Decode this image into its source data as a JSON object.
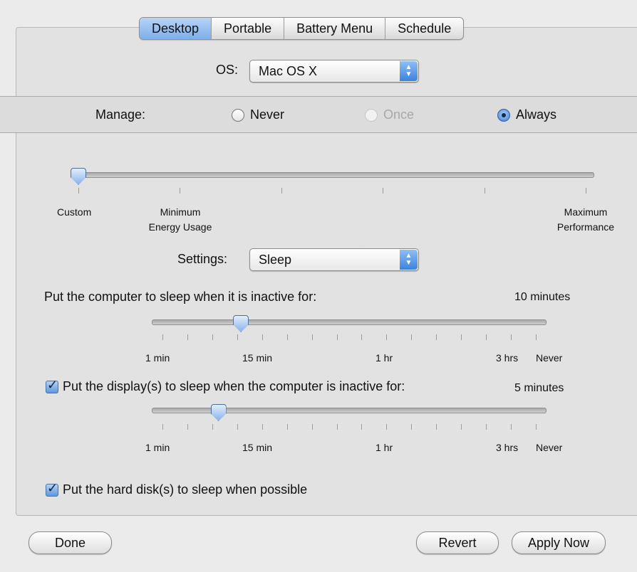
{
  "tabs": [
    "Desktop",
    "Portable",
    "Battery Menu",
    "Schedule"
  ],
  "os": {
    "label": "OS:",
    "value": "Mac OS X"
  },
  "manage": {
    "label": "Manage:",
    "options": [
      "Never",
      "Once",
      "Always"
    ],
    "selected": "Always",
    "disabled": [
      "Once"
    ]
  },
  "profile_slider": {
    "label_custom": "Custom",
    "label_min_1": "Minimum",
    "label_min_2": "Energy Usage",
    "label_max_1": "Maximum",
    "label_max_2": "Performance",
    "position": 0
  },
  "settings": {
    "label": "Settings:",
    "value": "Sleep"
  },
  "computer_sleep": {
    "label": "Put the computer to sleep when it is inactive for:",
    "value": "10 minutes",
    "ticks": [
      "1 min",
      "15 min",
      "1 hr",
      "3 hrs",
      "Never"
    ],
    "position": 0.21
  },
  "display_sleep": {
    "label": "Put the display(s) to sleep when the computer is inactive for:",
    "value": "5 minutes",
    "checked": true,
    "ticks": [
      "1 min",
      "15 min",
      "1 hr",
      "3 hrs",
      "Never"
    ],
    "position": 0.15
  },
  "disk_sleep": {
    "label": "Put the hard disk(s) to sleep when possible",
    "checked": true
  },
  "buttons": {
    "done": "Done",
    "revert": "Revert",
    "apply": "Apply Now"
  },
  "colors": {
    "accent": "#5d97e2",
    "tab_active": "#9cc3f1"
  }
}
